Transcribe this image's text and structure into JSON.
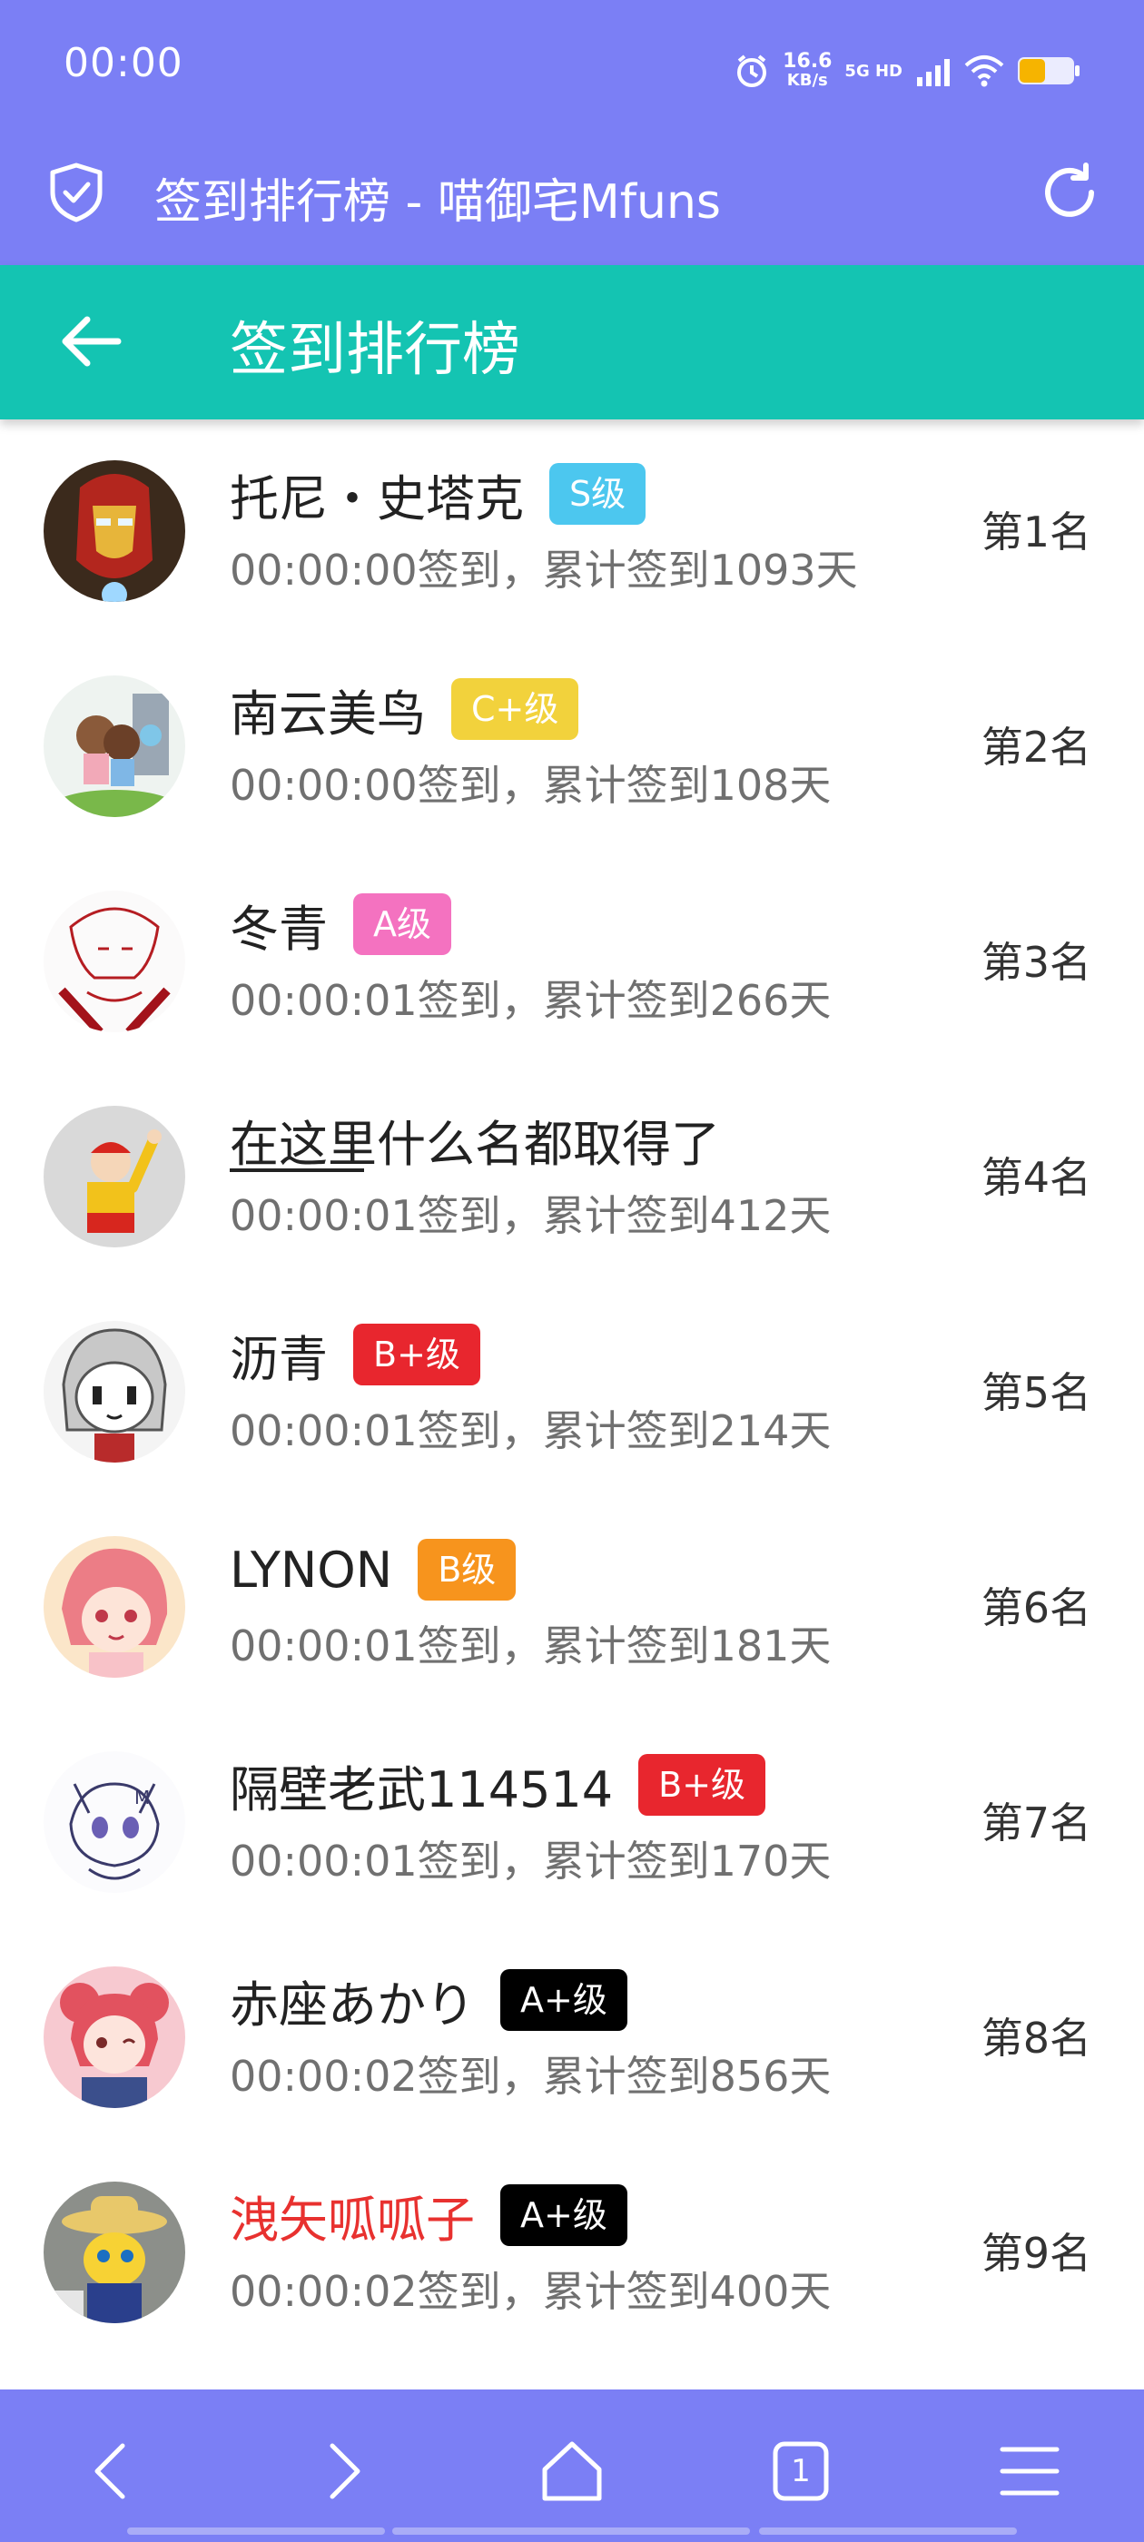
{
  "status_bar": {
    "time": "00:00",
    "speed_value": "16.6",
    "speed_unit": "KB/s",
    "network": "5G HD"
  },
  "browser": {
    "tab_title": "签到排行榜 - 喵御宅Mfuns"
  },
  "page": {
    "title": "签到排行榜"
  },
  "rankings": [
    {
      "name": "托尼・史塔克",
      "level": "S级",
      "level_color": "#4cc7ef",
      "info": "00:00:00签到，累计签到1093天",
      "rank": "第1名"
    },
    {
      "name": "南云美鸟",
      "level": "C+级",
      "level_color": "#f2d23c",
      "info": "00:00:00签到，累计签到108天",
      "rank": "第2名"
    },
    {
      "name": "冬青",
      "level": "A级",
      "level_color": "#f472c0",
      "info": "00:00:01签到，累计签到266天",
      "rank": "第3名"
    },
    {
      "name": "在这里什么名都取得了",
      "level": "",
      "level_color": "",
      "info": "00:00:01签到，累计签到412天",
      "rank": "第4名"
    },
    {
      "name": "沥青",
      "level": "B+级",
      "level_color": "#e8262e",
      "info": "00:00:01签到，累计签到214天",
      "rank": "第5名"
    },
    {
      "name": "LYNON",
      "level": "B级",
      "level_color": "#f7941d",
      "info": "00:00:01签到，累计签到181天",
      "rank": "第6名"
    },
    {
      "name": "隔壁老武114514",
      "level": "B+级",
      "level_color": "#e8262e",
      "info": "00:00:01签到，累计签到170天",
      "rank": "第7名"
    },
    {
      "name": "赤座あかり",
      "level": "A+级",
      "level_color": "#000000",
      "info": "00:00:02签到，累计签到856天",
      "rank": "第8名"
    },
    {
      "name": "洩矢呱呱子",
      "level": "A+级",
      "level_color": "#000000",
      "info": "00:00:02签到，累计签到400天",
      "rank": "第9名"
    }
  ],
  "bottom_nav": {
    "tab_count": "1"
  }
}
